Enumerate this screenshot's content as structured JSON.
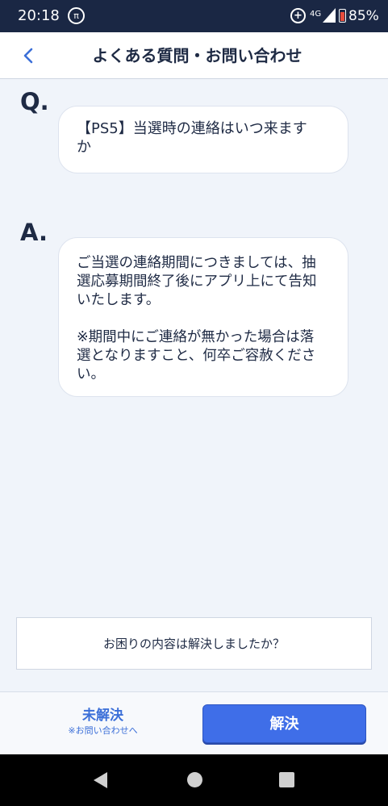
{
  "status_bar": {
    "time": "20:18",
    "pi_glyph": "π",
    "data_saver_glyph": "+",
    "network": "4G",
    "battery": "85%"
  },
  "header": {
    "back_icon": "chevron-left-icon",
    "title": "よくある質問・お問い合わせ"
  },
  "qa": {
    "q_label": "Q.",
    "question": "【PS5】当選時の連絡はいつ来ます\nか",
    "a_label": "A.",
    "answer": "ご当選の連絡期間につきましては、抽\n選応募期間終了後にアプリ上にて告知\nいたします。\n\n※期間中にご連絡が無かった場合は落\n選となりますこと、何卒ご容赦くださ\nい。"
  },
  "feedback": {
    "question": "お困りの内容は解決しましたか？",
    "unresolved_label": "未解決",
    "unresolved_sub": "※お問い合わせへ",
    "resolved_label": "解決"
  },
  "colors": {
    "accent": "#3f6ee8",
    "status_bar": "#1a2744",
    "background": "#f0f4fa",
    "text": "#1e2a44"
  },
  "nav": {
    "back_icon": "triangle-back-icon",
    "home_icon": "circle-home-icon",
    "recents_icon": "square-recents-icon"
  }
}
